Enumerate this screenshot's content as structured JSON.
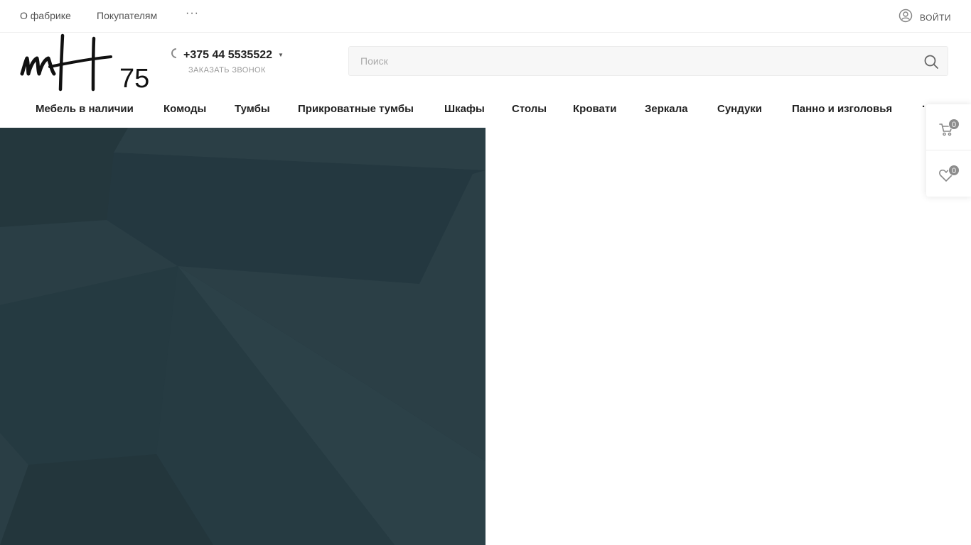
{
  "topbar": {
    "links": [
      "О фабрике",
      "Покупателям"
    ],
    "more_label": "···",
    "login_label": "ВОЙТИ"
  },
  "logo": {
    "script_text": "mH",
    "number": "75"
  },
  "contact": {
    "phone": "+375 44 5535522",
    "callback_label": "ЗАКАЗАТЬ ЗВОНОК"
  },
  "search": {
    "placeholder": "Поиск"
  },
  "menu": {
    "items": [
      "Мебель в наличии",
      "Комоды",
      "Тумбы",
      "Прикроватные тумбы",
      "Шкафы",
      "Столы",
      "Кровати",
      "Зеркала",
      "Сундуки",
      "Панно и изголовья"
    ],
    "more_label": "·"
  },
  "side_panel": {
    "cart_count": "0",
    "favorites_count": "0"
  },
  "colors": {
    "banner": "#263a40",
    "accent_badge": "#8c8c8c"
  }
}
